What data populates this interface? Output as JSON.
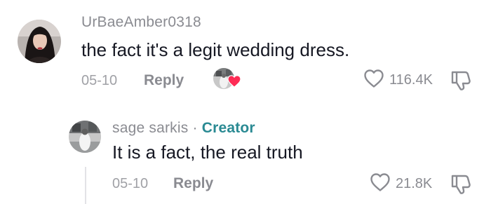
{
  "comments": [
    {
      "username": "UrBaeAmber0318",
      "text": "the fact it's a legit wedding dress.",
      "date": "05-10",
      "reply_label": "Reply",
      "likes": "116.4K"
    }
  ],
  "reply": {
    "username": "sage sarkis",
    "separator": "·",
    "creator_label": "Creator",
    "text": "It is a fact, the real truth",
    "date": "05-10",
    "reply_label": "Reply",
    "likes": "21.8K"
  },
  "icons": {
    "like": "heart-outline-icon",
    "dislike": "thumbs-down-outline-icon",
    "creator_liked": "creator-liked-heart-icon"
  },
  "colors": {
    "creator_tag": "#2a8a93",
    "liked_heart": "#fe2c55",
    "muted_text": "#8a8b91"
  }
}
